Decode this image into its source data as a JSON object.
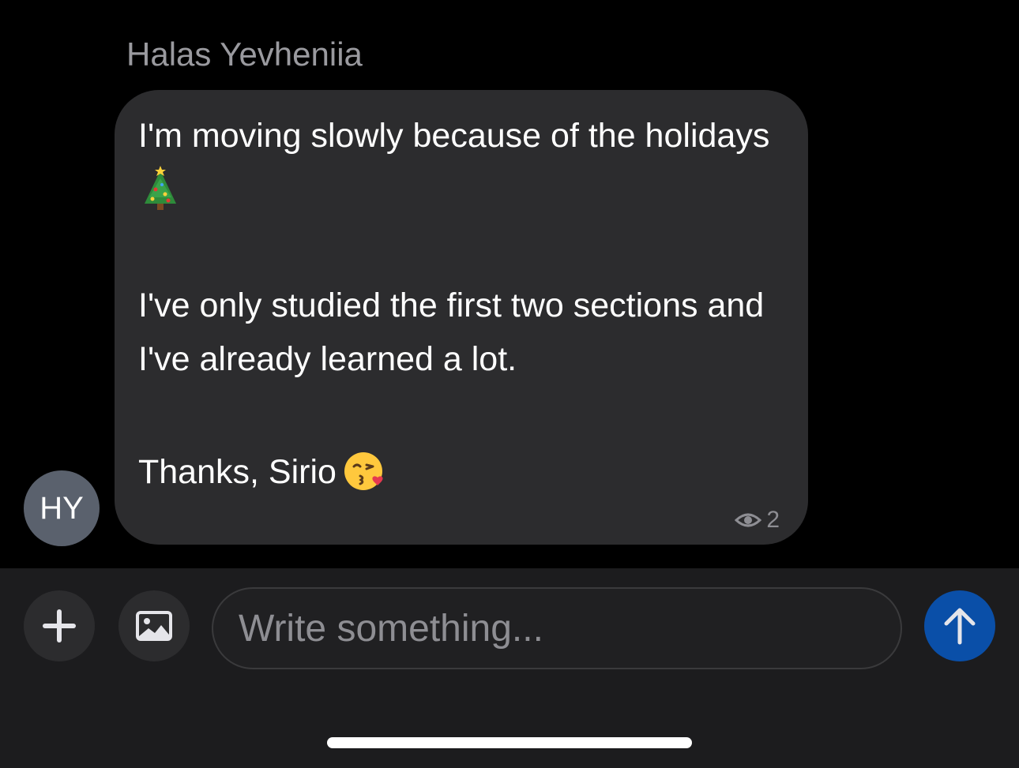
{
  "chat": {
    "sender_name": "Halas Yevheniia",
    "avatar_initials": "HY",
    "avatar_color": "#5a616d",
    "message": {
      "line1": "I'm moving slowly because of the holidays",
      "line1_emoji": "christmas-tree-icon",
      "line2": "I've only studied the first two sections and",
      "line3": "I've already learned a lot.",
      "line4": "Thanks, Sirio",
      "line4_emoji": "kissing-face-icon",
      "view_count": "2",
      "view_icon": "eye-icon"
    },
    "bubble_color": "#2c2c2e"
  },
  "composer": {
    "add_icon": "plus-icon",
    "image_icon": "image-icon",
    "input_placeholder": "Write something...",
    "input_value": "",
    "send_icon": "arrow-up-icon",
    "send_color": "#0a4fa8"
  }
}
